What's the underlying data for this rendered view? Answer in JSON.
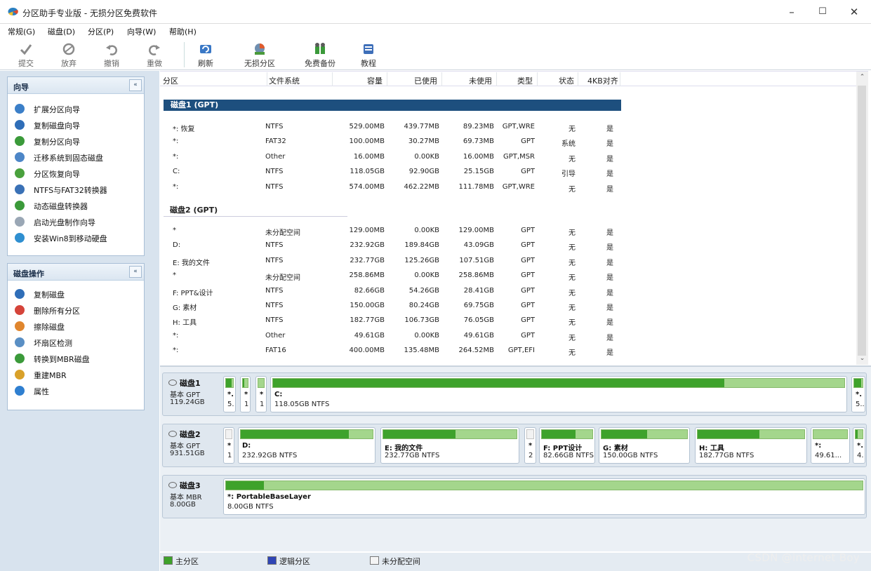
{
  "window": {
    "title": "分区助手专业版 - 无损分区免费软件",
    "min": "–",
    "max": "☐",
    "close": "✕"
  },
  "menu": [
    "常规(G)",
    "磁盘(D)",
    "分区(P)",
    "向导(W)",
    "帮助(H)"
  ],
  "toolbar": [
    {
      "label": "提交",
      "icon": "check-icon",
      "enabled": false
    },
    {
      "label": "放弃",
      "icon": "discard-icon",
      "enabled": false
    },
    {
      "label": "撤销",
      "icon": "undo-icon",
      "enabled": false
    },
    {
      "label": "重做",
      "icon": "redo-icon",
      "enabled": false
    },
    {
      "label": "刷新",
      "icon": "refresh-icon",
      "enabled": true
    },
    {
      "label": "无损分区",
      "icon": "partition-icon",
      "enabled": true
    },
    {
      "label": "免费备份",
      "icon": "backup-icon",
      "enabled": true
    },
    {
      "label": "教程",
      "icon": "tutorial-icon",
      "enabled": true
    }
  ],
  "wizard": {
    "title": "向导",
    "collapse": "«",
    "items": [
      "扩展分区向导",
      "复制磁盘向导",
      "复制分区向导",
      "迁移系统到固态磁盘",
      "分区恢复向导",
      "NTFS与FAT32转换器",
      "动态磁盘转换器",
      "启动光盘制作向导",
      "安装Win8到移动硬盘"
    ]
  },
  "diskops": {
    "title": "磁盘操作",
    "collapse": "«",
    "items": [
      "复制磁盘",
      "删除所有分区",
      "擦除磁盘",
      "坏扇区检测",
      "转换到MBR磁盘",
      "重建MBR",
      "属性"
    ]
  },
  "grid": {
    "columns": [
      "分区",
      "文件系统",
      "容量",
      "已使用",
      "未使用",
      "类型",
      "状态",
      "4KB对齐"
    ],
    "disk1": "磁盘1 (GPT)",
    "disk1_rows": [
      [
        "*: 恢复",
        "NTFS",
        "529.00MB",
        "439.77MB",
        "89.23MB",
        "GPT,WRE",
        "无",
        "是"
      ],
      [
        "*:",
        "FAT32",
        "100.00MB",
        "30.27MB",
        "69.73MB",
        "GPT",
        "系统",
        "是"
      ],
      [
        "*:",
        "Other",
        "16.00MB",
        "0.00KB",
        "16.00MB",
        "GPT,MSR",
        "无",
        "是"
      ],
      [
        "C:",
        "NTFS",
        "118.05GB",
        "92.90GB",
        "25.15GB",
        "GPT",
        "引导",
        "是"
      ],
      [
        "*:",
        "NTFS",
        "574.00MB",
        "462.22MB",
        "111.78MB",
        "GPT,WRE",
        "无",
        "是"
      ]
    ],
    "disk2": "磁盘2 (GPT)",
    "disk2_rows": [
      [
        "*",
        "未分配空间",
        "129.00MB",
        "0.00KB",
        "129.00MB",
        "GPT",
        "无",
        "是"
      ],
      [
        "D:",
        "NTFS",
        "232.92GB",
        "189.84GB",
        "43.09GB",
        "GPT",
        "无",
        "是"
      ],
      [
        "E: 我的文件",
        "NTFS",
        "232.77GB",
        "125.26GB",
        "107.51GB",
        "GPT",
        "无",
        "是"
      ],
      [
        "*",
        "未分配空间",
        "258.86MB",
        "0.00KB",
        "258.86MB",
        "GPT",
        "无",
        "是"
      ],
      [
        "F: PPT&设计",
        "NTFS",
        "82.66GB",
        "54.26GB",
        "28.41GB",
        "GPT",
        "无",
        "是"
      ],
      [
        "G: 素材",
        "NTFS",
        "150.00GB",
        "80.24GB",
        "69.75GB",
        "GPT",
        "无",
        "是"
      ],
      [
        "H: 工具",
        "NTFS",
        "182.77GB",
        "106.73GB",
        "76.05GB",
        "GPT",
        "无",
        "是"
      ],
      [
        "*:",
        "Other",
        "49.61GB",
        "0.00KB",
        "49.61GB",
        "GPT",
        "无",
        "是"
      ],
      [
        "*:",
        "FAT16",
        "400.00MB",
        "135.48MB",
        "264.52MB",
        "GPT,EFI",
        "无",
        "是"
      ]
    ]
  },
  "diskmap": [
    {
      "name": "磁盘1",
      "type": "基本 GPT",
      "size": "119.24GB",
      "parts": [
        {
          "n": "*.",
          "s": "5.",
          "used": 0.83
        },
        {
          "n": "*",
          "s": "1",
          "used": 0.3
        },
        {
          "n": "*",
          "s": "1",
          "used": 0.0
        },
        {
          "n": "C:",
          "s": "118.05GB NTFS",
          "used": 0.79
        },
        {
          "n": "*.",
          "s": "5..",
          "used": 0.81
        }
      ]
    },
    {
      "name": "磁盘2",
      "type": "基本 GPT",
      "size": "931.51GB",
      "parts": [
        {
          "n": "*",
          "s": "1",
          "used": 0.0,
          "un": true
        },
        {
          "n": "D:",
          "s": "232.92GB NTFS",
          "used": 0.82
        },
        {
          "n": "E: 我的文件",
          "s": "232.77GB NTFS",
          "used": 0.54
        },
        {
          "n": "*",
          "s": "2",
          "used": 0.0,
          "un": true
        },
        {
          "n": "F: PPT设计",
          "s": "82.66GB NTFS",
          "used": 0.66
        },
        {
          "n": "G: 素材",
          "s": "150.00GB NTFS",
          "used": 0.53
        },
        {
          "n": "H: 工具",
          "s": "182.77GB NTFS",
          "used": 0.58
        },
        {
          "n": "*:",
          "s": "49.61...",
          "used": 0.0
        },
        {
          "n": "*.",
          "s": "4.",
          "used": 0.34
        }
      ]
    },
    {
      "name": "磁盘3",
      "type": "基本 MBR",
      "size": "8.00GB",
      "parts": [
        {
          "n": "*: PortableBaseLayer",
          "s": "8.00GB NTFS",
          "used": 0.06
        }
      ]
    }
  ],
  "legend": [
    "主分区",
    "逻辑分区",
    "未分配空间"
  ],
  "watermark": "CSDN @internet  Boy",
  "colors": {
    "primary": "#3ea22b",
    "logical": "#2f45b5",
    "header": "#1d4f7e"
  }
}
